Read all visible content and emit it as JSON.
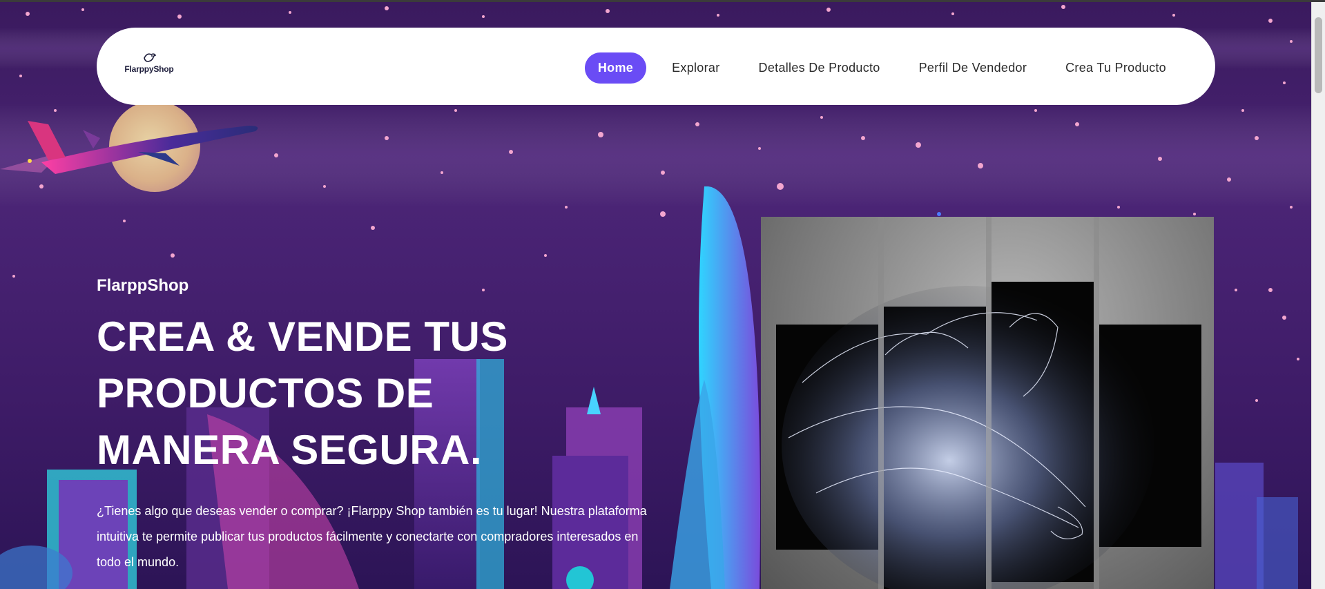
{
  "header": {
    "logo_text": "FlarppyShop",
    "nav": [
      {
        "label": "Home",
        "active": true
      },
      {
        "label": "Explorar",
        "active": false
      },
      {
        "label": "Detalles De Producto",
        "active": false
      },
      {
        "label": "Perfil De Vendedor",
        "active": false
      },
      {
        "label": "Crea Tu Producto",
        "active": false
      }
    ]
  },
  "hero": {
    "subtitle": "FlarppShop",
    "title": "CREA & VENDE TUS PRODUCTOS DE MANERA SEGURA.",
    "description": "¿Tienes algo que deseas vender o comprar? ¡Flarppy Shop también es tu lugar! Nuestra plataforma intuitiva te permite publicar tus productos fácilmente y conectarte con compradores interesados en todo el mundo."
  },
  "colors": {
    "accent": "#6a4cf5",
    "background": "#3a1a5e",
    "header_bg": "#ffffff"
  },
  "icons": {
    "logo": "bird-icon"
  }
}
